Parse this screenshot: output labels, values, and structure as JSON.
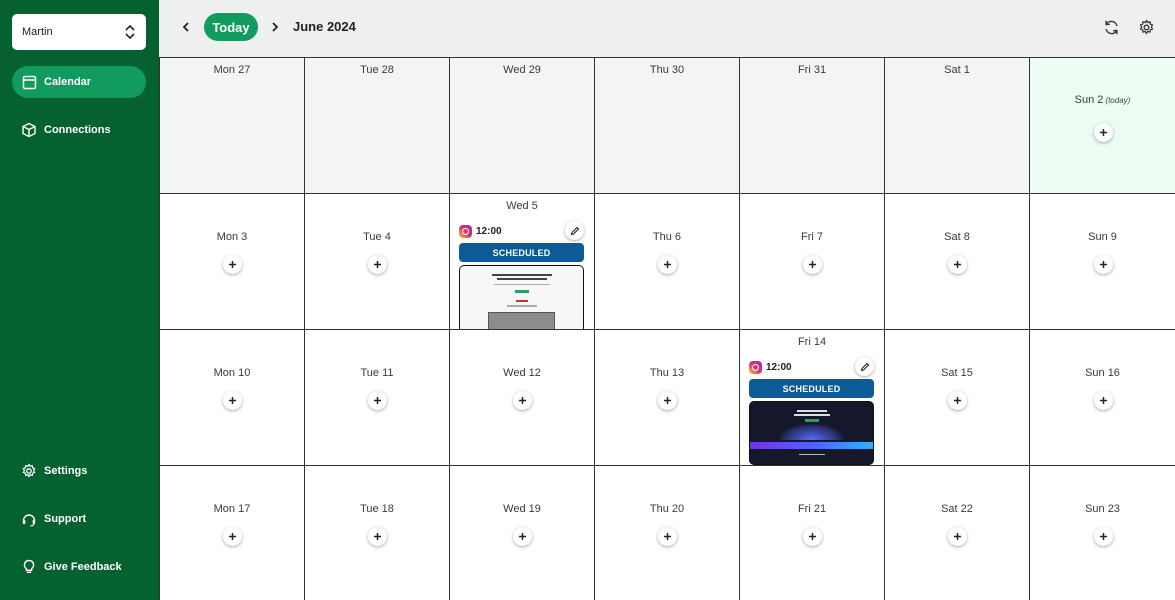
{
  "sidebar": {
    "account": "Martin",
    "nav": [
      {
        "label": "Calendar",
        "icon": "calendar-icon",
        "active": true
      },
      {
        "label": "Connections",
        "icon": "cube-icon",
        "active": false
      }
    ],
    "bottom": [
      {
        "label": "Settings",
        "icon": "gear-icon"
      },
      {
        "label": "Support",
        "icon": "headset-icon"
      },
      {
        "label": "Give Feedback",
        "icon": "lightbulb-icon"
      }
    ]
  },
  "header": {
    "today_label": "Today",
    "month": "June 2024"
  },
  "calendar": {
    "today_tag": "(today)",
    "weeks": [
      [
        {
          "label": "Mon 27",
          "state": "past"
        },
        {
          "label": "Tue 28",
          "state": "past"
        },
        {
          "label": "Wed 29",
          "state": "past"
        },
        {
          "label": "Thu 30",
          "state": "past"
        },
        {
          "label": "Fri 31",
          "state": "past"
        },
        {
          "label": "Sat 1",
          "state": "past"
        },
        {
          "label": "Sun 2",
          "state": "today"
        }
      ],
      [
        {
          "label": "Mon 3"
        },
        {
          "label": "Tue 4"
        },
        {
          "label": "Wed 5",
          "post": {
            "time": "12:00",
            "status": "SCHEDULED",
            "thumb": "light"
          }
        },
        {
          "label": "Thu 6"
        },
        {
          "label": "Fri 7"
        },
        {
          "label": "Sat 8"
        },
        {
          "label": "Sun 9"
        }
      ],
      [
        {
          "label": "Mon 10"
        },
        {
          "label": "Tue 11"
        },
        {
          "label": "Wed 12"
        },
        {
          "label": "Thu 13"
        },
        {
          "label": "Fri 14",
          "post": {
            "time": "12:00",
            "status": "SCHEDULED",
            "thumb": "dark"
          }
        },
        {
          "label": "Sat 15"
        },
        {
          "label": "Sun 16"
        }
      ],
      [
        {
          "label": "Mon 17"
        },
        {
          "label": "Tue 18"
        },
        {
          "label": "Wed 19"
        },
        {
          "label": "Thu 20"
        },
        {
          "label": "Fri 21"
        },
        {
          "label": "Sat 22"
        },
        {
          "label": "Sun 23"
        }
      ]
    ]
  },
  "colors": {
    "sidebar": "#05612f",
    "accent": "#129b5e",
    "scheduled": "#0d5b96",
    "today_cell": "#edfcf3"
  }
}
